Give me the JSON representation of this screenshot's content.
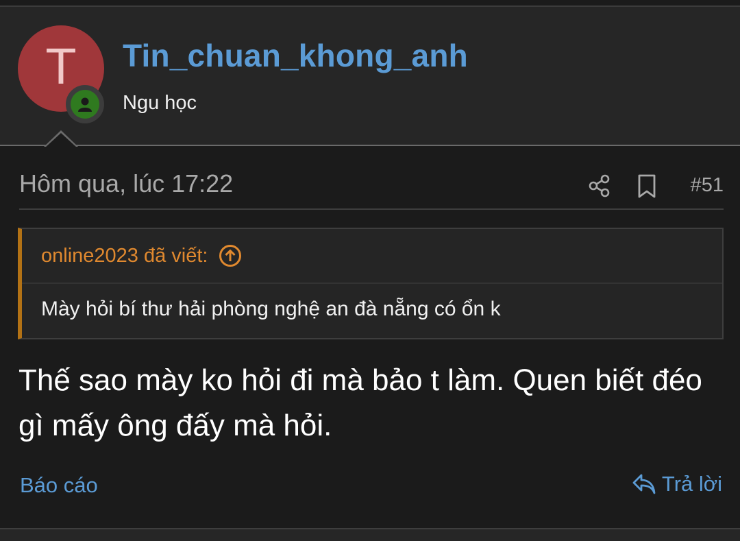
{
  "user": {
    "avatar_letter": "T",
    "username": "Tin_chuan_khong_anh",
    "title": "Ngu học",
    "avatar_color": "#a0373a",
    "online_badge_color": "#2f7a1f"
  },
  "post": {
    "date": "Hôm qua, lúc 17:22",
    "number": "#51",
    "share_icon": "share-icon",
    "bookmark_icon": "bookmark-icon",
    "quote": {
      "author": "online2023 đã viết:",
      "text": "Mày hỏi bí thư hải phòng nghệ an đà nẵng có ổn k"
    },
    "body": "Thế sao mày ko hỏi đi mà bảo t làm. Quen biết đéo gì mấy ông đấy mà hỏi."
  },
  "actions": {
    "report": "Báo cáo",
    "reply": "Trả lời"
  },
  "colors": {
    "link": "#5b9bd5",
    "quote_accent": "#b37215",
    "quote_author": "#e0892f",
    "background": "#1b1b1b"
  }
}
